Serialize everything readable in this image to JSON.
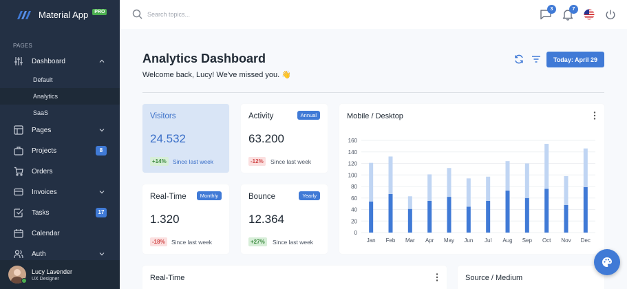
{
  "brand": {
    "name": "Material App",
    "badge": "PRO"
  },
  "sidebar": {
    "section": "PAGES",
    "items": [
      {
        "label": "Dashboard",
        "icon": "sliders-icon",
        "expanded": true
      },
      {
        "label": "Pages",
        "icon": "layout-icon"
      },
      {
        "label": "Projects",
        "icon": "briefcase-icon",
        "badge": "8"
      },
      {
        "label": "Orders",
        "icon": "cart-icon"
      },
      {
        "label": "Invoices",
        "icon": "credit-card-icon"
      },
      {
        "label": "Tasks",
        "icon": "check-square-icon",
        "badge": "17"
      },
      {
        "label": "Calendar",
        "icon": "calendar-icon"
      },
      {
        "label": "Auth",
        "icon": "users-icon"
      }
    ],
    "dashboard_sub": [
      {
        "label": "Default"
      },
      {
        "label": "Analytics",
        "active": true
      },
      {
        "label": "SaaS"
      }
    ]
  },
  "user": {
    "name": "Lucy Lavender",
    "role": "UX Designer",
    "status": "online"
  },
  "topbar": {
    "search_placeholder": "Search topics...",
    "messages_count": "3",
    "notifications_count": "7",
    "language_icon": "us-flag-icon"
  },
  "header": {
    "title": "Analytics Dashboard",
    "welcome": "Welcome back, Lucy! We've missed you. 👋",
    "date_button": "Today: April 29"
  },
  "stats": [
    {
      "title": "Visitors",
      "value": "24.532",
      "pct": "+14%",
      "trend": "up",
      "since": "Since last week"
    },
    {
      "title": "Activity",
      "value": "63.200",
      "pct": "-12%",
      "trend": "down",
      "since": "Since last week",
      "chip": "Annual"
    },
    {
      "title": "Real-Time",
      "value": "1.320",
      "pct": "-18%",
      "trend": "down",
      "since": "Since last week",
      "chip": "Monthly"
    },
    {
      "title": "Bounce",
      "value": "12.364",
      "pct": "+27%",
      "trend": "up",
      "since": "Since last week",
      "chip": "Yearly"
    }
  ],
  "bottom_cards": {
    "realtime_title": "Real-Time",
    "source_title": "Source / Medium"
  },
  "colors": {
    "primary": "#407ad6",
    "primary_light": "#c0d5f3",
    "sidebar": "#233044",
    "positive": "#4caf50",
    "negative": "#d04848"
  },
  "chart_data": {
    "type": "bar",
    "stacked": true,
    "title": "Mobile / Desktop",
    "categories": [
      "Jan",
      "Feb",
      "Mar",
      "Apr",
      "May",
      "Jun",
      "Jul",
      "Aug",
      "Sep",
      "Oct",
      "Nov",
      "Dec"
    ],
    "series": [
      {
        "values": [
          54,
          67,
          41,
          55,
          62,
          45,
          55,
          73,
          60,
          76,
          48,
          79
        ],
        "color": "#407ad6"
      },
      {
        "values": [
          67,
          65,
          22,
          46,
          50,
          49,
          42,
          51,
          60,
          78,
          50,
          67
        ],
        "color": "#c0d5f3"
      }
    ],
    "ylim": [
      0,
      160
    ],
    "yticks": [
      0,
      20,
      40,
      60,
      80,
      100,
      120,
      140,
      160
    ],
    "grid": true,
    "legend": "none"
  }
}
